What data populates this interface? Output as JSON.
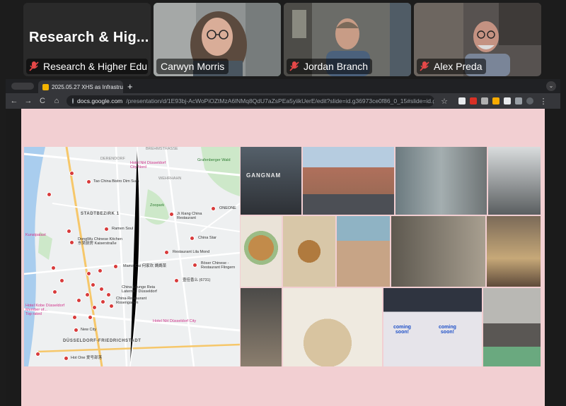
{
  "participants": [
    {
      "name": "Research & Higher Edu...",
      "title": "Research & Hig...",
      "muted": true,
      "active": false
    },
    {
      "name": "Carwyn Morris",
      "muted": false,
      "active": true
    },
    {
      "name": "Jordan Branch",
      "muted": true,
      "active": false
    },
    {
      "name": "Alex Preda",
      "muted": true,
      "active": false
    }
  ],
  "browser": {
    "tab_title": "2025.05.27 XHS as Infrastruc",
    "tab_close": "×",
    "new_tab": "+",
    "url_host": "docs.google.com",
    "url_path": "/presentation/d/1E93bj-AcWoPiOZtMzA6lNMq8QdU7aZsPEa5yiikUerE/edit?slide=id.g36973ce0f86_0_15#slide=id.g36973ce...",
    "back": "←",
    "forward": "→",
    "reload": "C",
    "home": "⌂",
    "star": "☆",
    "menu": "⋮",
    "tabmenu": "⌄"
  },
  "map": {
    "labels": {
      "stadtbezirk": "STADTBEZIRK 1",
      "duesseldorf_stadt": "DÜSSELDORF-FRIEDRICHSTADT",
      "hotel_nh": "Hotel NH Düsseldorf\nCity Nord",
      "hotel_nh_city": "Hotel NH Düsseldorf City",
      "grafenberger": "Grafenberger Wald",
      "zoopark": "Zoopark",
      "kunstpalast": "Kunstpalast",
      "oneone": "ONEONE",
      "tao": "Tao China Bistro Dim Sum",
      "ji_xiang": "Ji Xiang China\nRestaurant",
      "ramen": "Ramen Soul",
      "dongwu": "DongWu Chinese Kitchen\n东吴厨房 Kaiserstraße",
      "china_star": "China Star",
      "lila_mond": "Restaurant Lila Mond",
      "mama_cai": "Mama Cai 何家欢 媽媽菜",
      "boeser": "Böser Chinese -\nRestaurant Flingern",
      "jia": "壹佳香么 (6731)",
      "lounge": "China Lounge Reia\nLaterne - Düsseldorf",
      "rosengarten": "China-Restaurant\nRosengarten",
      "kobe": "Hotel Kobe Düsseldorf\nMember of...\nTop rated",
      "new_city": "New City",
      "hot_one": "Hot One 爱号部落",
      "wehrhahn": "WEHRHAHN",
      "derendorf": "DERENDORF",
      "brehmstr": "BREHMSTRASSE"
    }
  },
  "photos": {
    "gangnam_sign": "GANGNAM",
    "coming_soon": "coming\nsoon!"
  }
}
